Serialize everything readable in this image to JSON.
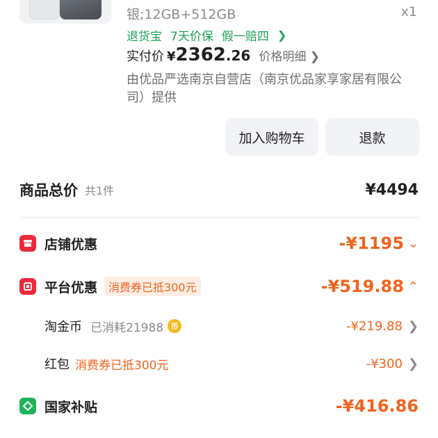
{
  "product": {
    "spec": "银;12GB+512GB",
    "quantity": "x1",
    "guarantees": [
      "退货宝",
      "7天价保",
      "假一赔四"
    ],
    "paid_label": "实付价",
    "currency": "¥",
    "paid_int": "2362",
    "paid_dec": ".26",
    "price_detail": "价格明细",
    "seller": "由优品严选南京自营店（南京优品家享家居有限公司）提供",
    "buttons": {
      "add_cart": "加入购物车",
      "refund": "退款"
    }
  },
  "summary": {
    "total_label": "商品总价",
    "count": "共1件",
    "total": "¥4494",
    "store_discount": {
      "label": "店铺优惠",
      "amount": "-¥1195"
    },
    "platform_discount": {
      "label": "平台优惠",
      "tag": "消费券已抵300元",
      "amount": "-¥519.88",
      "items": [
        {
          "label": "淘金币",
          "note": "已消耗21988",
          "amount": "-¥219.88"
        },
        {
          "label": "红包",
          "note": "消费券已抵300元",
          "amount": "-¥300"
        }
      ]
    },
    "subsidy": {
      "label": "国家补贴",
      "amount": "-¥416.86"
    }
  },
  "colors": {
    "accent": "#f0641e",
    "guarantee": "#1fa15a",
    "icon_red": "#f0283c",
    "icon_green": "#1fb25a",
    "coin": "#f5b91e"
  }
}
